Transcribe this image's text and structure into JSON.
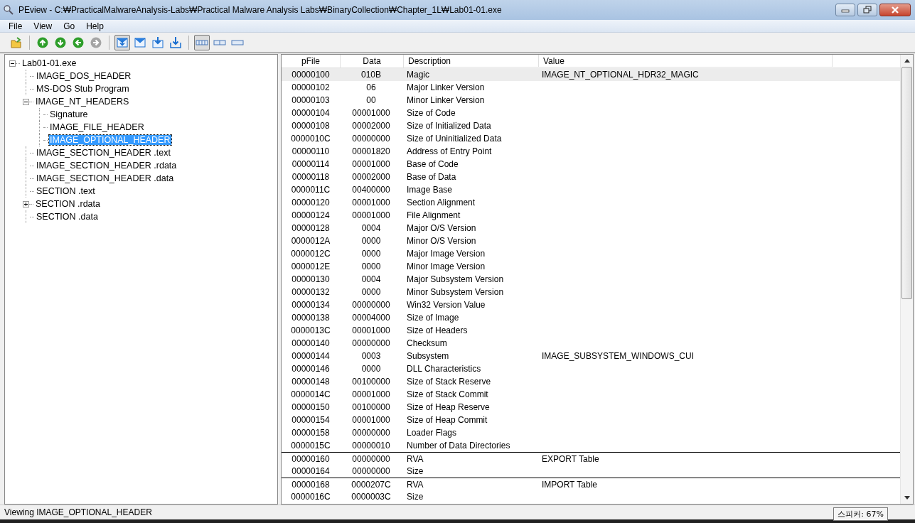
{
  "window": {
    "title": "PEview - C:₩PracticalMalwareAnalysis-Labs₩Practical Malware Analysis Labs₩BinaryCollection₩Chapter_1L₩Lab01-01.exe"
  },
  "menu": [
    "File",
    "View",
    "Go",
    "Help"
  ],
  "toolbar": [
    {
      "kind": "open",
      "pressed": false
    },
    {
      "kind": "sep"
    },
    {
      "kind": "up",
      "pressed": false,
      "disabled": false
    },
    {
      "kind": "down",
      "pressed": false,
      "disabled": false
    },
    {
      "kind": "back",
      "pressed": false,
      "disabled": false
    },
    {
      "kind": "forward",
      "pressed": false,
      "disabled": true
    },
    {
      "kind": "sep"
    },
    {
      "kind": "mail-down",
      "pressed": true
    },
    {
      "kind": "mail",
      "pressed": false
    },
    {
      "kind": "mail-arrow",
      "pressed": false
    },
    {
      "kind": "tray-arrow",
      "pressed": false
    },
    {
      "kind": "sep"
    },
    {
      "kind": "view-wide",
      "pressed": true
    },
    {
      "kind": "view-split",
      "pressed": false
    },
    {
      "kind": "view-single",
      "pressed": false
    }
  ],
  "tree": [
    {
      "label": "Lab01-01.exe",
      "selected": false,
      "expanded": true,
      "children": [
        {
          "label": "IMAGE_DOS_HEADER",
          "selected": false
        },
        {
          "label": "MS-DOS Stub Program",
          "selected": false
        },
        {
          "label": "IMAGE_NT_HEADERS",
          "selected": false,
          "expanded": true,
          "children": [
            {
              "label": "Signature",
              "selected": false
            },
            {
              "label": "IMAGE_FILE_HEADER",
              "selected": false
            },
            {
              "label": "IMAGE_OPTIONAL_HEADER",
              "selected": true
            }
          ]
        },
        {
          "label": "IMAGE_SECTION_HEADER .text",
          "selected": false
        },
        {
          "label": "IMAGE_SECTION_HEADER .rdata",
          "selected": false
        },
        {
          "label": "IMAGE_SECTION_HEADER .data",
          "selected": false
        },
        {
          "label": "SECTION .text",
          "selected": false
        },
        {
          "label": "SECTION .rdata",
          "selected": false,
          "expanded": false
        },
        {
          "label": "SECTION .data",
          "selected": false
        }
      ]
    }
  ],
  "table": {
    "columns": [
      "pFile",
      "Data",
      "Description",
      "Value"
    ],
    "rows": [
      {
        "cells": [
          "00000100",
          "010B",
          "Magic",
          "IMAGE_NT_OPTIONAL_HDR32_MAGIC"
        ],
        "selected": true,
        "separator_above": false
      },
      {
        "cells": [
          "00000102",
          "06",
          "Major Linker Version",
          ""
        ],
        "selected": false,
        "separator_above": false
      },
      {
        "cells": [
          "00000103",
          "00",
          "Minor Linker Version",
          ""
        ],
        "selected": false,
        "separator_above": false
      },
      {
        "cells": [
          "00000104",
          "00001000",
          "Size of Code",
          ""
        ],
        "selected": false,
        "separator_above": false
      },
      {
        "cells": [
          "00000108",
          "00002000",
          "Size of Initialized Data",
          ""
        ],
        "selected": false,
        "separator_above": false
      },
      {
        "cells": [
          "0000010C",
          "00000000",
          "Size of Uninitialized Data",
          ""
        ],
        "selected": false,
        "separator_above": false
      },
      {
        "cells": [
          "00000110",
          "00001820",
          "Address of Entry Point",
          ""
        ],
        "selected": false,
        "separator_above": false
      },
      {
        "cells": [
          "00000114",
          "00001000",
          "Base of Code",
          ""
        ],
        "selected": false,
        "separator_above": false
      },
      {
        "cells": [
          "00000118",
          "00002000",
          "Base of Data",
          ""
        ],
        "selected": false,
        "separator_above": false
      },
      {
        "cells": [
          "0000011C",
          "00400000",
          "Image Base",
          ""
        ],
        "selected": false,
        "separator_above": false
      },
      {
        "cells": [
          "00000120",
          "00001000",
          "Section Alignment",
          ""
        ],
        "selected": false,
        "separator_above": false
      },
      {
        "cells": [
          "00000124",
          "00001000",
          "File Alignment",
          ""
        ],
        "selected": false,
        "separator_above": false
      },
      {
        "cells": [
          "00000128",
          "0004",
          "Major O/S Version",
          ""
        ],
        "selected": false,
        "separator_above": false
      },
      {
        "cells": [
          "0000012A",
          "0000",
          "Minor O/S Version",
          ""
        ],
        "selected": false,
        "separator_above": false
      },
      {
        "cells": [
          "0000012C",
          "0000",
          "Major Image Version",
          ""
        ],
        "selected": false,
        "separator_above": false
      },
      {
        "cells": [
          "0000012E",
          "0000",
          "Minor Image Version",
          ""
        ],
        "selected": false,
        "separator_above": false
      },
      {
        "cells": [
          "00000130",
          "0004",
          "Major Subsystem Version",
          ""
        ],
        "selected": false,
        "separator_above": false
      },
      {
        "cells": [
          "00000132",
          "0000",
          "Minor Subsystem Version",
          ""
        ],
        "selected": false,
        "separator_above": false
      },
      {
        "cells": [
          "00000134",
          "00000000",
          "Win32 Version Value",
          ""
        ],
        "selected": false,
        "separator_above": false
      },
      {
        "cells": [
          "00000138",
          "00004000",
          "Size of Image",
          ""
        ],
        "selected": false,
        "separator_above": false
      },
      {
        "cells": [
          "0000013C",
          "00001000",
          "Size of Headers",
          ""
        ],
        "selected": false,
        "separator_above": false
      },
      {
        "cells": [
          "00000140",
          "00000000",
          "Checksum",
          ""
        ],
        "selected": false,
        "separator_above": false
      },
      {
        "cells": [
          "00000144",
          "0003",
          "Subsystem",
          "IMAGE_SUBSYSTEM_WINDOWS_CUI"
        ],
        "selected": false,
        "separator_above": false
      },
      {
        "cells": [
          "00000146",
          "0000",
          "DLL Characteristics",
          ""
        ],
        "selected": false,
        "separator_above": false
      },
      {
        "cells": [
          "00000148",
          "00100000",
          "Size of Stack Reserve",
          ""
        ],
        "selected": false,
        "separator_above": false
      },
      {
        "cells": [
          "0000014C",
          "00001000",
          "Size of Stack Commit",
          ""
        ],
        "selected": false,
        "separator_above": false
      },
      {
        "cells": [
          "00000150",
          "00100000",
          "Size of Heap Reserve",
          ""
        ],
        "selected": false,
        "separator_above": false
      },
      {
        "cells": [
          "00000154",
          "00001000",
          "Size of Heap Commit",
          ""
        ],
        "selected": false,
        "separator_above": false
      },
      {
        "cells": [
          "00000158",
          "00000000",
          "Loader Flags",
          ""
        ],
        "selected": false,
        "separator_above": false
      },
      {
        "cells": [
          "0000015C",
          "00000010",
          "Number of Data Directories",
          ""
        ],
        "selected": false,
        "separator_above": false
      },
      {
        "cells": [
          "00000160",
          "00000000",
          "RVA",
          "EXPORT Table"
        ],
        "selected": false,
        "separator_above": true
      },
      {
        "cells": [
          "00000164",
          "00000000",
          "Size",
          ""
        ],
        "selected": false,
        "separator_above": false
      },
      {
        "cells": [
          "00000168",
          "0000207C",
          "RVA",
          "IMPORT Table"
        ],
        "selected": false,
        "separator_above": true
      },
      {
        "cells": [
          "0000016C",
          "0000003C",
          "Size",
          ""
        ],
        "selected": false,
        "separator_above": false
      }
    ]
  },
  "status_bar": "Viewing IMAGE_OPTIONAL_HEADER",
  "tooltip": "스피커: 67%"
}
